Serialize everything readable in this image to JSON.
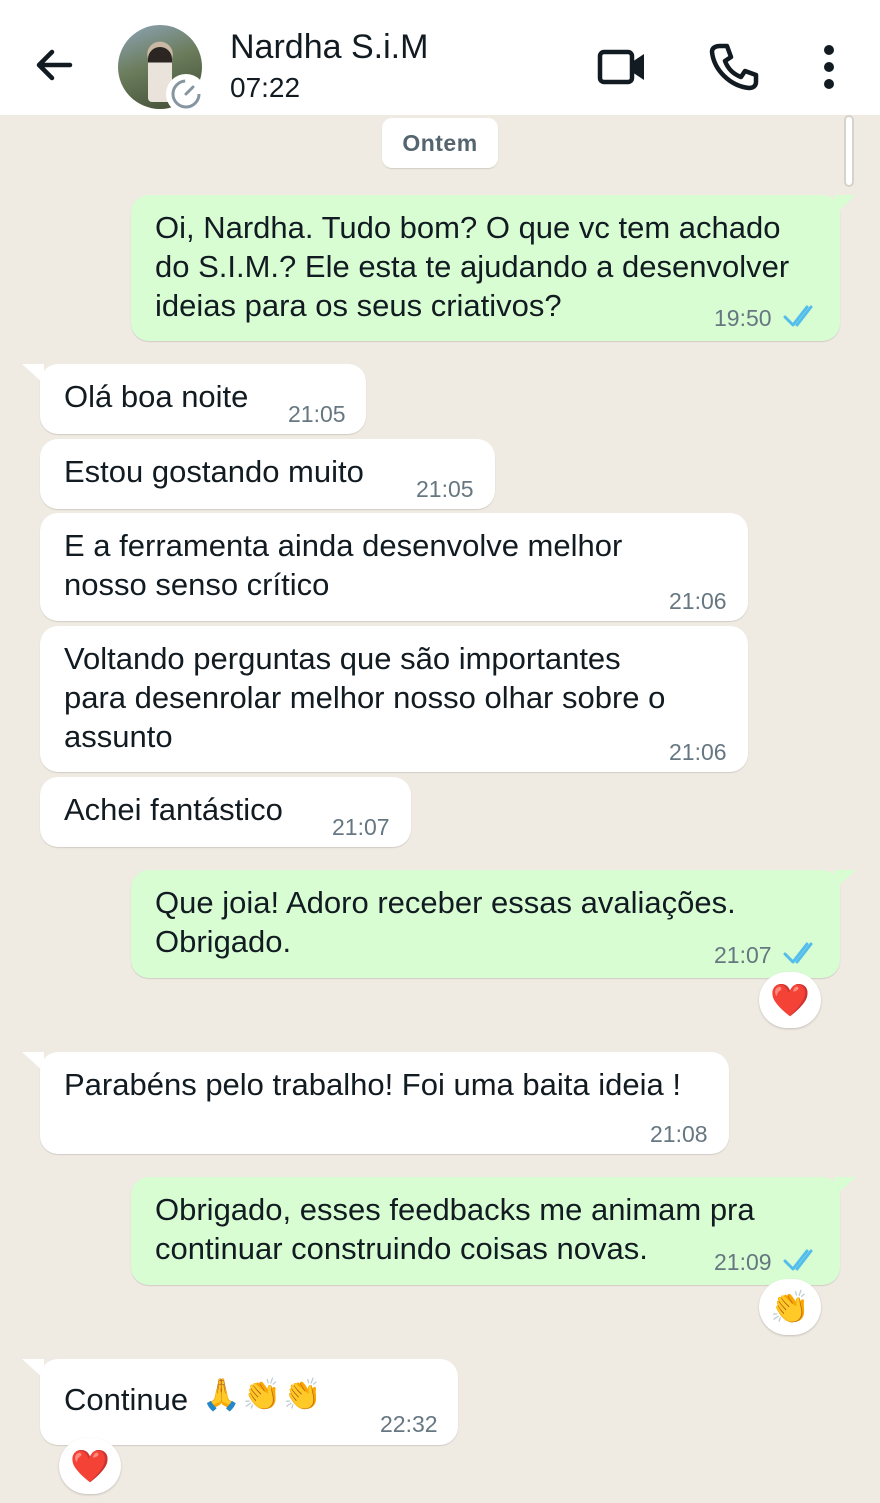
{
  "header": {
    "contact_name": "Nardha S.i.M",
    "last_seen": "07:22",
    "icons": [
      "arrow-left-icon",
      "timer-icon",
      "video-camera-icon",
      "phone-icon",
      "more-vertical-icon"
    ]
  },
  "chat": {
    "date_separator": "Ontem",
    "messages": [
      {
        "direction": "out",
        "lines": [
          "Oi, Nardha. Tudo bom? O que vc tem achado",
          "do S.I.M.? Ele esta te ajudando a desenvolver",
          "ideias para os seus criativos?"
        ],
        "time": "19:50",
        "status": "read"
      },
      {
        "direction": "in",
        "lines": [
          "Olá boa noite"
        ],
        "time": "21:05"
      },
      {
        "direction": "in",
        "lines": [
          "Estou gostando muito"
        ],
        "time": "21:05"
      },
      {
        "direction": "in",
        "lines": [
          "E a ferramenta ainda desenvolve melhor",
          "nosso senso crítico"
        ],
        "time": "21:06"
      },
      {
        "direction": "in",
        "lines": [
          "Voltando perguntas que são importantes",
          "para desenrolar melhor nosso olhar sobre o",
          "assunto"
        ],
        "time": "21:06"
      },
      {
        "direction": "in",
        "lines": [
          "Achei fantástico"
        ],
        "time": "21:07"
      },
      {
        "direction": "out",
        "lines": [
          "Que joia! Adoro receber essas avaliações.",
          "Obrigado."
        ],
        "time": "21:07",
        "status": "read",
        "reaction": "❤️"
      },
      {
        "direction": "in",
        "lines": [
          "Parabéns pelo trabalho! Foi uma baita ideia !"
        ],
        "time": "21:08"
      },
      {
        "direction": "out",
        "lines": [
          "Obrigado, esses feedbacks me animam pra",
          "continuar construindo coisas novas."
        ],
        "time": "21:09",
        "status": "read",
        "reaction": "👏"
      },
      {
        "direction": "in",
        "lines": [
          "Continue"
        ],
        "emojis": "🙏👏👏",
        "time": "22:32",
        "reaction": "❤️"
      }
    ]
  },
  "colors": {
    "wallpaper": "#efeae2",
    "outgoing_bubble": "#d9fdd3",
    "incoming_bubble": "#ffffff",
    "read_tick": "#53bdeb",
    "heart": "#e8303a"
  }
}
